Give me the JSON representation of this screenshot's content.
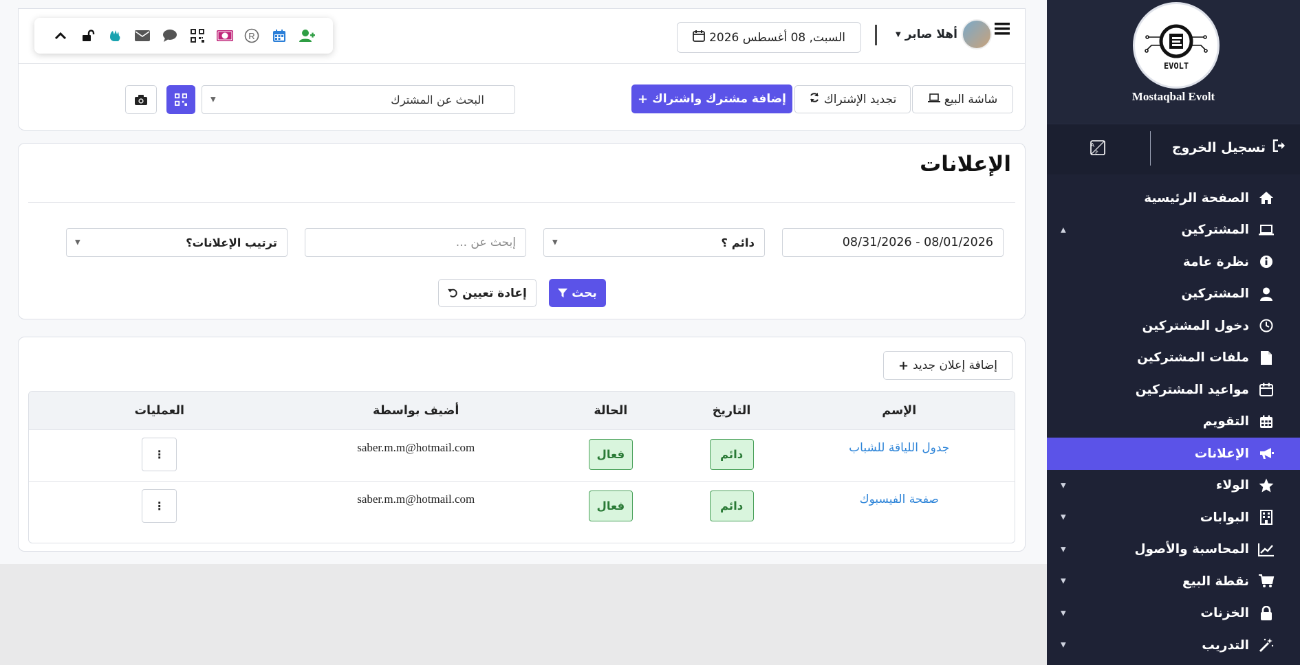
{
  "sidebar": {
    "brand": "Mostaqbal Evolt",
    "logo_text": "EVOLT",
    "logout_label": "تسجيل الخروج",
    "items": [
      {
        "label": "الصفحة الرئيسية",
        "icon": "home-icon"
      },
      {
        "label": "المشتركين",
        "icon": "laptop-icon",
        "caret": "▲"
      },
      {
        "label": "نظرة عامة",
        "icon": "info-icon"
      },
      {
        "label": "المشتركين",
        "icon": "user-icon"
      },
      {
        "label": "دخول المشتركين",
        "icon": "clock-icon"
      },
      {
        "label": "ملفات المشتركين",
        "icon": "file-icon"
      },
      {
        "label": "مواعيد المشتركين",
        "icon": "calendar-icon"
      },
      {
        "label": "التقويم",
        "icon": "calendar-grid-icon"
      },
      {
        "label": "الإعلانات",
        "icon": "megaphone-icon"
      },
      {
        "label": "الولاء",
        "icon": "star-icon",
        "caret": "▼"
      },
      {
        "label": "البوابات",
        "icon": "building-icon",
        "caret": "▼"
      },
      {
        "label": "المحاسبة والأصول",
        "icon": "chart-line-icon",
        "caret": "▼"
      },
      {
        "label": "نقطة البيع",
        "icon": "cart-icon",
        "caret": "▼"
      },
      {
        "label": "الخزنات",
        "icon": "lock-icon",
        "caret": "▼"
      },
      {
        "label": "التدريب",
        "icon": "magic-wand-icon",
        "caret": "▼"
      }
    ]
  },
  "header": {
    "greeting": "أهلا صابر",
    "date": "السبت, 08 أغسطس 2026",
    "toolbar_icons": [
      "chevron-up-icon",
      "unlock-icon",
      "hand-icon",
      "envelope-icon",
      "comment-icon",
      "qrcode-icon",
      "money-icon",
      "registered-icon",
      "calendar-icon",
      "user-plus-icon"
    ]
  },
  "actions": {
    "pos_screen": "شاشة البيع",
    "renew": "تجديد الإشتراك",
    "add_member": "إضافة مشترك واشتراك",
    "search_member_placeholder": "البحث عن المشترك"
  },
  "ads": {
    "title": "الإعلانات",
    "filters": {
      "date_range": "08/01/2026 - 08/31/2026",
      "permanent": "دائم ؟",
      "search_placeholder": "إبحث عن ...",
      "sort": "ترتيب الإعلانات؟"
    },
    "search_btn": "بحث",
    "reset_btn": "إعادة تعيين"
  },
  "list": {
    "add_btn": "إضافة إعلان جديد",
    "columns": {
      "name": "الإسم",
      "date": "التاريخ",
      "status": "الحالة",
      "added_by": "أضيف بواسطة",
      "ops": "العمليات"
    },
    "rows": [
      {
        "name": "جدول اللياقة للشباب",
        "date": "دائم",
        "status": "فعال",
        "added_by": "saber.m.m@hotmail.com",
        "ops": "⋮"
      },
      {
        "name": "صفحة الفيسبوك",
        "date": "دائم",
        "status": "فعال",
        "added_by": "saber.m.m@hotmail.com",
        "ops": "⋮"
      }
    ]
  },
  "colors": {
    "accent": "#5b53e8",
    "sidebar": "#1e2235",
    "success": "#2a7a36",
    "link": "#2d84d8"
  }
}
